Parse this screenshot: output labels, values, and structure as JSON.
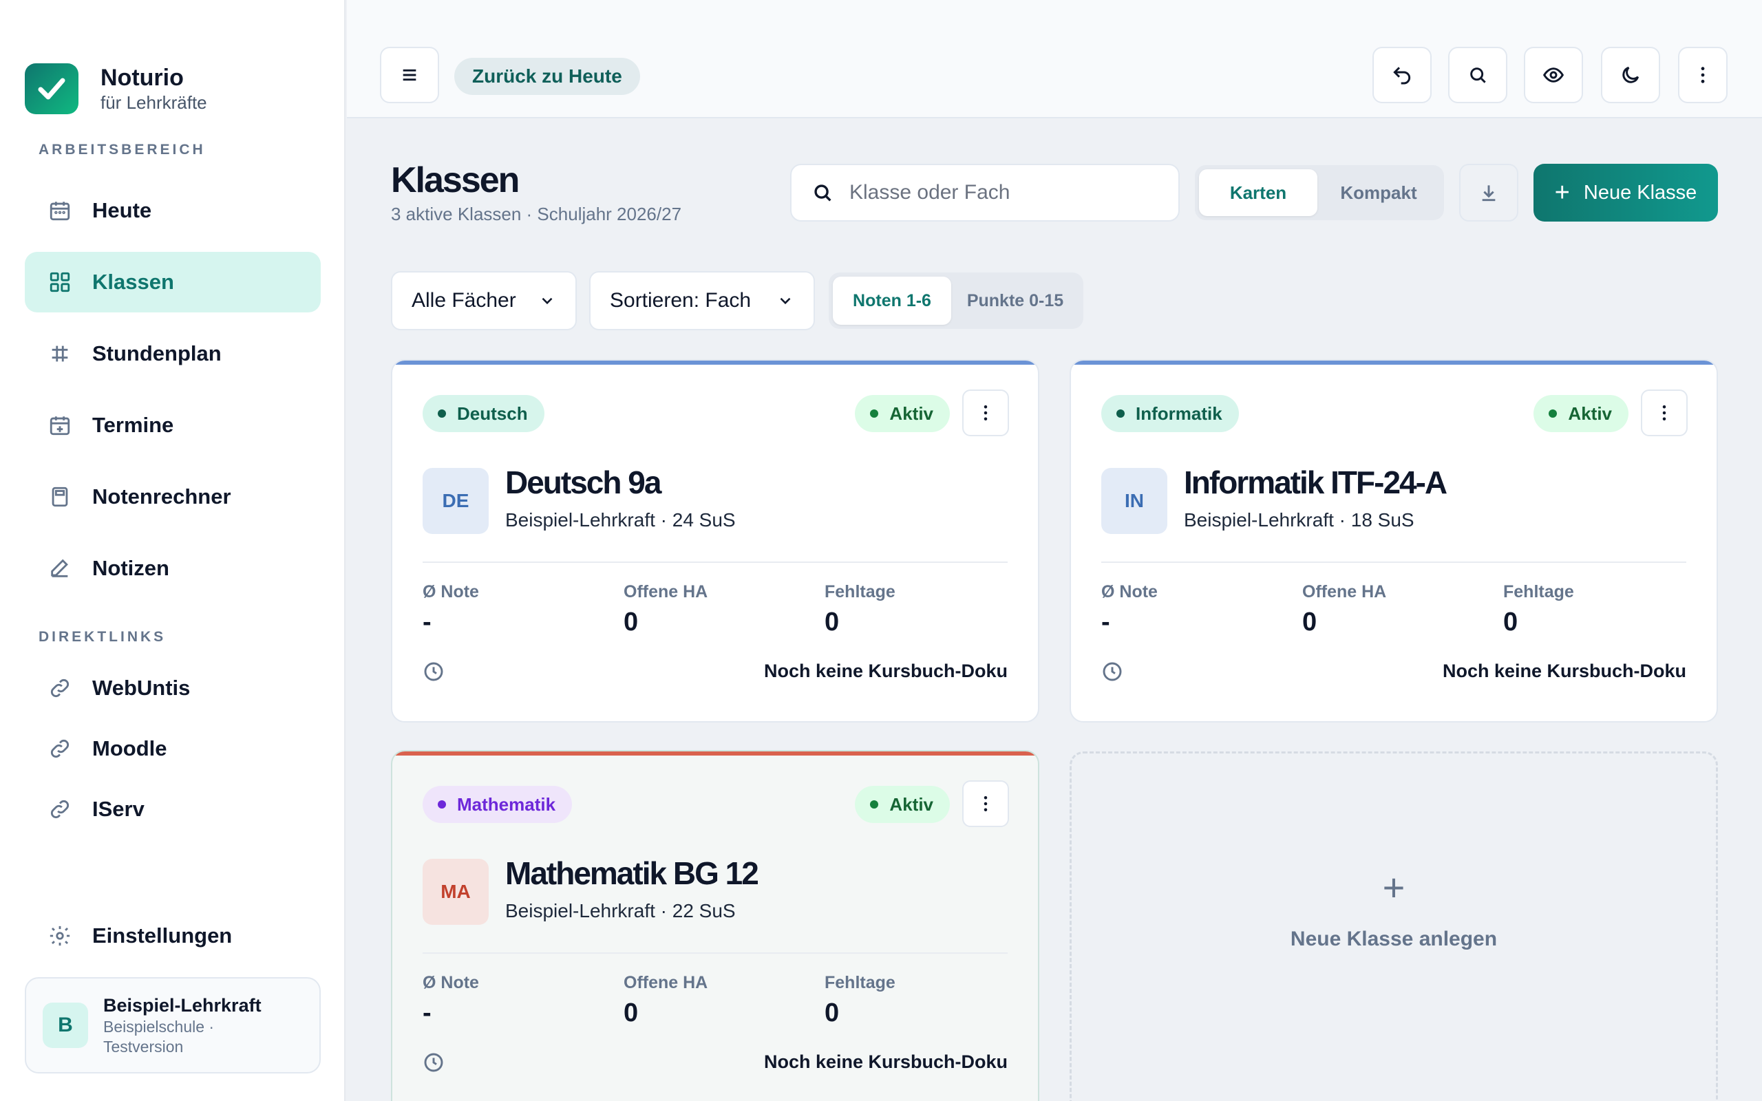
{
  "brand": {
    "name": "Noturio",
    "subtitle": "für Lehrkräfte"
  },
  "sidebar": {
    "section_workspace": "ARBEITSBEREICH",
    "section_links": "DIREKTLINKS",
    "items": [
      {
        "label": "Heute",
        "icon": "calendar-icon",
        "active": false
      },
      {
        "label": "Klassen",
        "icon": "grid-icon",
        "active": true
      },
      {
        "label": "Stundenplan",
        "icon": "timetable-icon",
        "active": false
      },
      {
        "label": "Termine",
        "icon": "calendar-plus-icon",
        "active": false
      },
      {
        "label": "Notenrechner",
        "icon": "calculator-icon",
        "active": false
      },
      {
        "label": "Notizen",
        "icon": "pencil-icon",
        "active": false
      }
    ],
    "links": [
      {
        "label": "WebUntis",
        "icon": "link-icon"
      },
      {
        "label": "Moodle",
        "icon": "link-icon"
      },
      {
        "label": "IServ",
        "icon": "link-icon"
      }
    ],
    "settings_label": "Einstellungen",
    "user": {
      "initial": "B",
      "name": "Beispiel-Lehrkraft",
      "school": "Beispielschule · Testversion"
    }
  },
  "topbar": {
    "back_label": "Zurück zu Heute",
    "icons": [
      "menu-icon",
      "undo-icon",
      "search-icon",
      "eye-icon",
      "moon-icon",
      "more-vertical-icon"
    ]
  },
  "main": {
    "title": "Klassen",
    "subtitle": "3 aktive Klassen · Schuljahr 2026/27",
    "search_placeholder": "Klasse oder Fach",
    "view_options": [
      "Karten",
      "Kompakt"
    ],
    "view_selected": "Karten",
    "new_class_label": "Neue Klasse",
    "filter_subject": "Alle Fächer",
    "sort_label": "Sortieren: Fach",
    "grade_options": [
      "Noten 1-6",
      "Punkte 0-15"
    ],
    "grade_selected": "Noten 1-6",
    "add_card_label": "Neue Klasse anlegen"
  },
  "cards": [
    {
      "subject": "Deutsch",
      "status": "Aktiv",
      "abbr": "DE",
      "title": "Deutsch 9a",
      "sub": "Beispiel-Lehrkraft · 24 SuS",
      "stat_labels": [
        "Ø Note",
        "Offene HA",
        "Fehltage"
      ],
      "stat_values": [
        "-",
        "0",
        "0"
      ],
      "doku": "Noch keine Kursbuch-Doku",
      "colors": {
        "accent": "#6b93d6",
        "chip_bg": "#d7f5ec",
        "chip_fg": "#0f5f4c",
        "abbr_bg": "#e3ebf7",
        "abbr_fg": "#3b6db3"
      }
    },
    {
      "subject": "Informatik",
      "status": "Aktiv",
      "abbr": "IN",
      "title": "Informatik ITF-24-A",
      "sub": "Beispiel-Lehrkraft · 18 SuS",
      "stat_labels": [
        "Ø Note",
        "Offene HA",
        "Fehltage"
      ],
      "stat_values": [
        "-",
        "0",
        "0"
      ],
      "doku": "Noch keine Kursbuch-Doku",
      "colors": {
        "accent": "#6b93d6",
        "chip_bg": "#d7f5ec",
        "chip_fg": "#0f5f4c",
        "abbr_bg": "#e3ebf7",
        "abbr_fg": "#3b6db3"
      }
    },
    {
      "subject": "Mathematik",
      "status": "Aktiv",
      "abbr": "MA",
      "title": "Mathematik BG 12",
      "sub": "Beispiel-Lehrkraft · 22 SuS",
      "stat_labels": [
        "Ø Note",
        "Offene HA",
        "Fehltage"
      ],
      "stat_values": [
        "-",
        "0",
        "0"
      ],
      "doku": "Noch keine Kursbuch-Doku",
      "colors": {
        "accent": "#d9624e",
        "chip_bg": "#efe5fb",
        "chip_fg": "#6d28d9",
        "abbr_bg": "#f6e3e0",
        "abbr_fg": "#c2412d"
      }
    }
  ]
}
